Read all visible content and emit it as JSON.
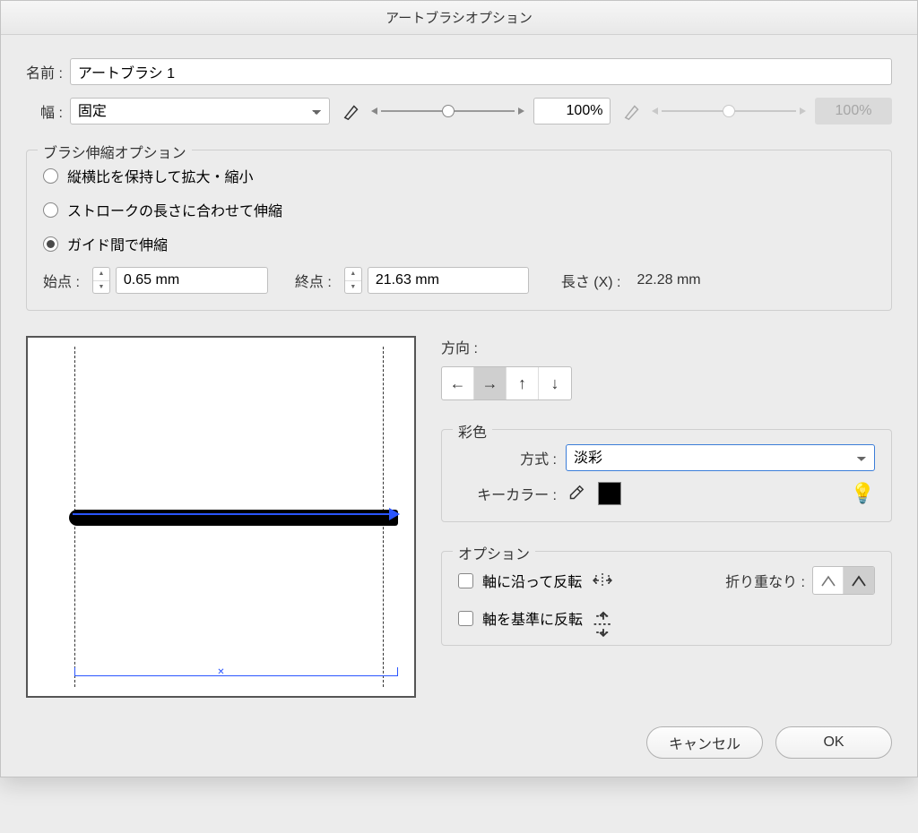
{
  "title": "アートブラシオプション",
  "name": {
    "label": "名前 :",
    "value": "アートブラシ 1"
  },
  "width": {
    "label": "幅 :",
    "mode": "固定",
    "value1": "100%",
    "value2_disabled": "100%"
  },
  "stretch": {
    "group_title": "ブラシ伸縮オプション",
    "opt1": "縦横比を保持して拡大・縮小",
    "opt2": "ストロークの長さに合わせて伸縮",
    "opt3": "ガイド間で伸縮",
    "start_label": "始点 :",
    "start_value": "0.65 mm",
    "end_label": "終点 :",
    "end_value": "21.63 mm",
    "length_label": "長さ (X) :",
    "length_value": "22.28 mm"
  },
  "direction": {
    "group_title": "方向 :"
  },
  "colorization": {
    "group_title": "彩色",
    "method_label": "方式 :",
    "method_value": "淡彩",
    "keycolor_label": "キーカラー :"
  },
  "options": {
    "group_title": "オプション",
    "flip_along": "軸に沿って反転",
    "flip_across": "軸を基準に反転",
    "overlap_label": "折り重なり :"
  },
  "footer": {
    "cancel": "キャンセル",
    "ok": "OK"
  }
}
